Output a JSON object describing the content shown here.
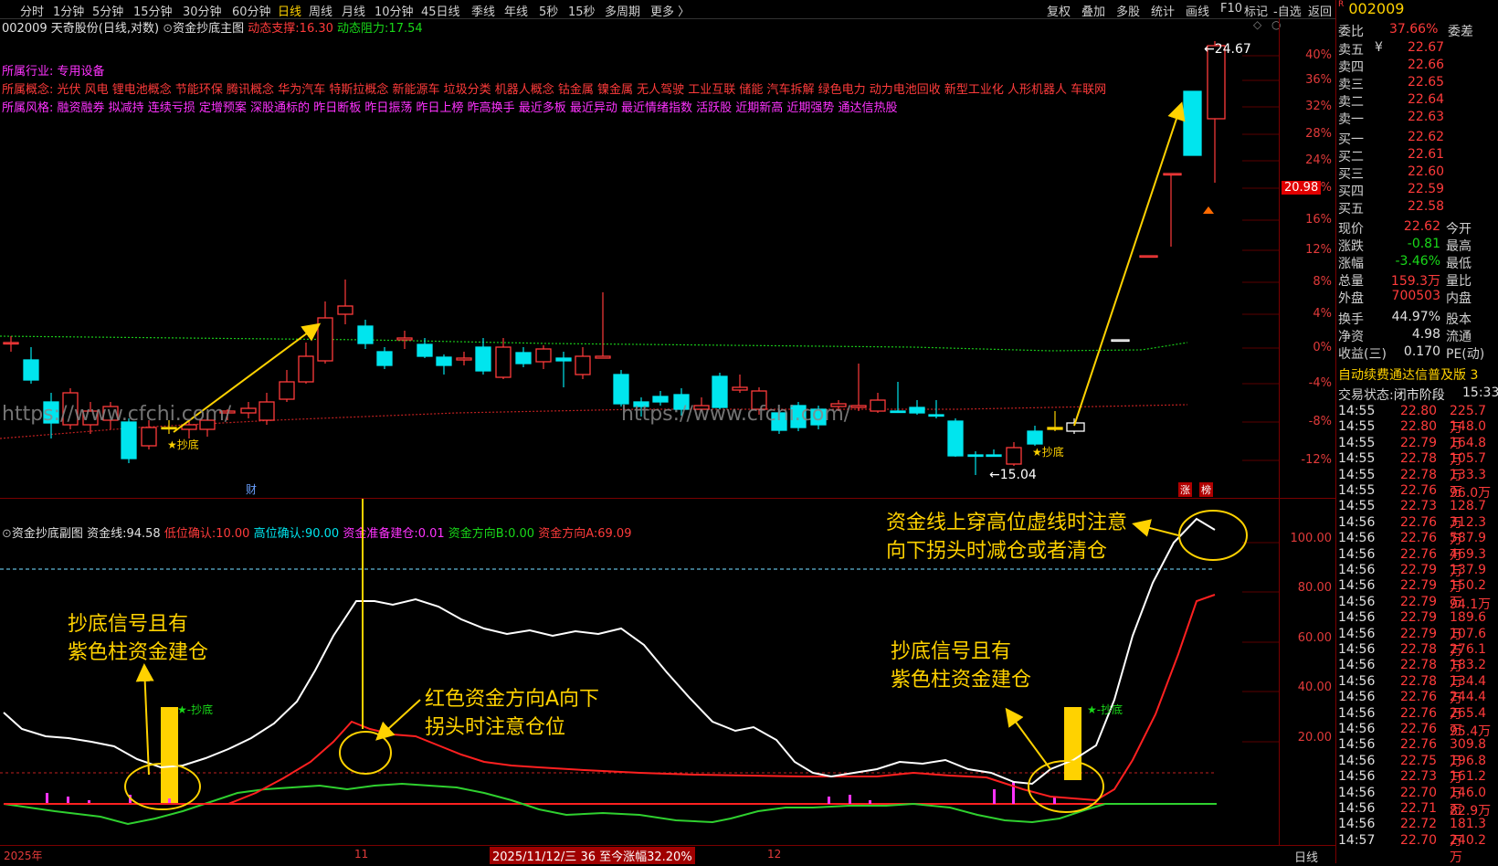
{
  "toolbar": {
    "periods": [
      "分时",
      "1分钟",
      "5分钟",
      "15分钟",
      "30分钟",
      "60分钟",
      "日线",
      "周线",
      "月线",
      "10分钟",
      "45日线",
      "季线",
      "年线",
      "5秒",
      "15秒",
      "多周期",
      "更多 〉"
    ],
    "active_period": "日线",
    "right_tools": [
      "复权",
      "叠加",
      "多股",
      "统计",
      "画线",
      "F10",
      "标记",
      "-自选",
      "返回"
    ]
  },
  "info": {
    "code": "002009",
    "name": "天奇股份",
    "mode": "(日线,对数)",
    "indicator": "资金抄底主图",
    "support_label": "动态支撑:",
    "support_value": "16.30",
    "resist_label": "动态阻力:",
    "resist_value": "17.54"
  },
  "tags": {
    "industry_label": "所属行业:",
    "industry": "专用设备",
    "concept_label": "所属概念:",
    "concepts": "光伏 风电 锂电池概念 节能环保 腾讯概念 华为汽车 特斯拉概念 新能源车 垃圾分类 机器人概念 钴金属 镍金属 无人驾驶 工业互联 储能 汽车拆解 绿色电力 动力电池回收 新型工业化 人形机器人 车联网",
    "style_label": "所属风格:",
    "styles": "融资融券 拟减持 连续亏损 定增预案 深股通标的 昨日断板 昨日振荡 昨日上榜 昨高换手 最近多板 最近异动 最近情绪指数 活跃股 近期新高 近期强势 通达信热股"
  },
  "main_chart": {
    "high_label": "24.67",
    "low_label": "15.04",
    "current_price_tag": "20.98",
    "pct_axis": [
      "40%",
      "36%",
      "32%",
      "28%",
      "24%",
      "20%",
      "16%",
      "12%",
      "8%",
      "4%",
      "0%",
      "-4%",
      "-8%",
      "-12%"
    ],
    "signal_label": "★抄底",
    "watermark": "https://www.cfchi.com/",
    "finance_mark": "财",
    "limit_marks": [
      "涨",
      "榜"
    ]
  },
  "sub_chart": {
    "title": "资金抄底副图",
    "line_label": "资金线:",
    "line_value": "94.58",
    "low_label": "低位确认:",
    "low_value": "10.00",
    "high_label": "高位确认:",
    "high_value": "90.00",
    "prep_label": "资金准备建仓:",
    "prep_value": "0.01",
    "dirB_label": "资金方向B:",
    "dirB_value": "0.00",
    "dirA_label": "资金方向A:",
    "dirA_value": "69.09",
    "axis": [
      "100.00",
      "80.00",
      "60.00",
      "40.00",
      "20.00"
    ],
    "signal_label": "★-抄底"
  },
  "annotations": {
    "a1_l1": "抄底信号且有",
    "a1_l2": "紫色柱资金建仓",
    "a2_l1": "红色资金方向A向下",
    "a2_l2": "拐头时注意仓位",
    "a3_l1": "抄底信号且有",
    "a3_l2": "紫色柱资金建仓",
    "a4_l1": "资金线上穿高位虚线时注意",
    "a4_l2": "向下拐头时减仓或者清仓"
  },
  "time_axis": {
    "year": "2025年",
    "m11": "11",
    "m12": "12",
    "cursor": "2025/11/12/三 36 至今涨幅32.20%",
    "right": "日线"
  },
  "quote": {
    "title_code": "002009",
    "title_name": "天奇股份",
    "webi_label": "委比",
    "webi": "37.66%",
    "weicha_label": "委差",
    "asks": [
      {
        "label": "卖五",
        "mark": "¥",
        "price": "22.67"
      },
      {
        "label": "卖四",
        "mark": "",
        "price": "22.66"
      },
      {
        "label": "卖三",
        "mark": "",
        "price": "22.65"
      },
      {
        "label": "卖二",
        "mark": "",
        "price": "22.64"
      },
      {
        "label": "卖一",
        "mark": "",
        "price": "22.63"
      }
    ],
    "bids": [
      {
        "label": "买一",
        "price": "22.62"
      },
      {
        "label": "买二",
        "price": "22.61"
      },
      {
        "label": "买三",
        "price": "22.60"
      },
      {
        "label": "买四",
        "price": "22.59"
      },
      {
        "label": "买五",
        "price": "22.58"
      }
    ],
    "stats": [
      {
        "l": "现价",
        "v": "22.62",
        "r": "今开"
      },
      {
        "l": "涨跌",
        "v": "-0.81",
        "r": "最高"
      },
      {
        "l": "涨幅",
        "v": "-3.46%",
        "r": "最低"
      },
      {
        "l": "总量",
        "v": "159.3万",
        "r": "量比"
      },
      {
        "l": "外盘",
        "v": "700503",
        "r": "内盘"
      },
      {
        "l": "换手",
        "v": "44.97%",
        "r": "股本"
      },
      {
        "l": "净资",
        "v": "4.98",
        "r": "流通"
      },
      {
        "l": "收益(三)",
        "v": "0.170",
        "r": "PE(动)"
      }
    ],
    "notice": "自动续费通达信普及版",
    "notice_tail": "3",
    "status_label": "交易状态:",
    "status": "闭市阶段",
    "status_time": "15:33"
  },
  "trades": [
    {
      "t": "14:55",
      "p": "22.80",
      "v": "225.7万",
      "c": "up"
    },
    {
      "t": "14:55",
      "p": "22.80",
      "v": "148.0万",
      "c": "up"
    },
    {
      "t": "14:55",
      "p": "22.79",
      "v": "164.8万",
      "c": "up"
    },
    {
      "t": "14:55",
      "p": "22.78",
      "v": "105.7万",
      "c": "up"
    },
    {
      "t": "14:55",
      "p": "22.78",
      "v": "133.3万",
      "c": "up"
    },
    {
      "t": "14:55",
      "p": "22.76",
      "v": "96.0万",
      "c": "up"
    },
    {
      "t": "14:55",
      "p": "22.73",
      "v": "128.7万",
      "c": "up"
    },
    {
      "t": "14:56",
      "p": "22.76",
      "v": "312.3万",
      "c": "up"
    },
    {
      "t": "14:56",
      "p": "22.76",
      "v": "587.9万",
      "c": "up"
    },
    {
      "t": "14:56",
      "p": "22.76",
      "v": "469.3万",
      "c": "up"
    },
    {
      "t": "14:56",
      "p": "22.79",
      "v": "137.9万",
      "c": "up"
    },
    {
      "t": "14:56",
      "p": "22.79",
      "v": "150.2万",
      "c": "up"
    },
    {
      "t": "14:56",
      "p": "22.79",
      "v": "94.1万",
      "c": "up"
    },
    {
      "t": "14:56",
      "p": "22.79",
      "v": "189.6万",
      "c": "up"
    },
    {
      "t": "14:56",
      "p": "22.79",
      "v": "107.6万",
      "c": "up"
    },
    {
      "t": "14:56",
      "p": "22.78",
      "v": "276.1万",
      "c": "up"
    },
    {
      "t": "14:56",
      "p": "22.78",
      "v": "183.2万",
      "c": "up"
    },
    {
      "t": "14:56",
      "p": "22.78",
      "v": "134.4万",
      "c": "up"
    },
    {
      "t": "14:56",
      "p": "22.76",
      "v": "244.4万",
      "c": "up"
    },
    {
      "t": "14:56",
      "p": "22.76",
      "v": "265.4万",
      "c": "up"
    },
    {
      "t": "14:56",
      "p": "22.76",
      "v": "95.4万",
      "c": "up"
    },
    {
      "t": "14:56",
      "p": "22.76",
      "v": "309.8万",
      "c": "up"
    },
    {
      "t": "14:56",
      "p": "22.75",
      "v": "196.8万",
      "c": "up"
    },
    {
      "t": "14:56",
      "p": "22.73",
      "v": "161.2万",
      "c": "up"
    },
    {
      "t": "14:56",
      "p": "22.70",
      "v": "146.0万",
      "c": "up"
    },
    {
      "t": "14:56",
      "p": "22.71",
      "v": "82.9万",
      "c": "up"
    },
    {
      "t": "14:56",
      "p": "22.72",
      "v": "181.3万",
      "c": "up"
    },
    {
      "t": "14:57",
      "p": "22.70",
      "v": "240.2万",
      "c": "up"
    }
  ],
  "colors": {
    "up": "#ff3b3b",
    "down": "#00e5ee",
    "gold": "#ffd200",
    "line_white": "#ffffff",
    "line_red": "#ff2020",
    "line_green": "#2fd02f",
    "purple": "#ff33ff"
  }
}
